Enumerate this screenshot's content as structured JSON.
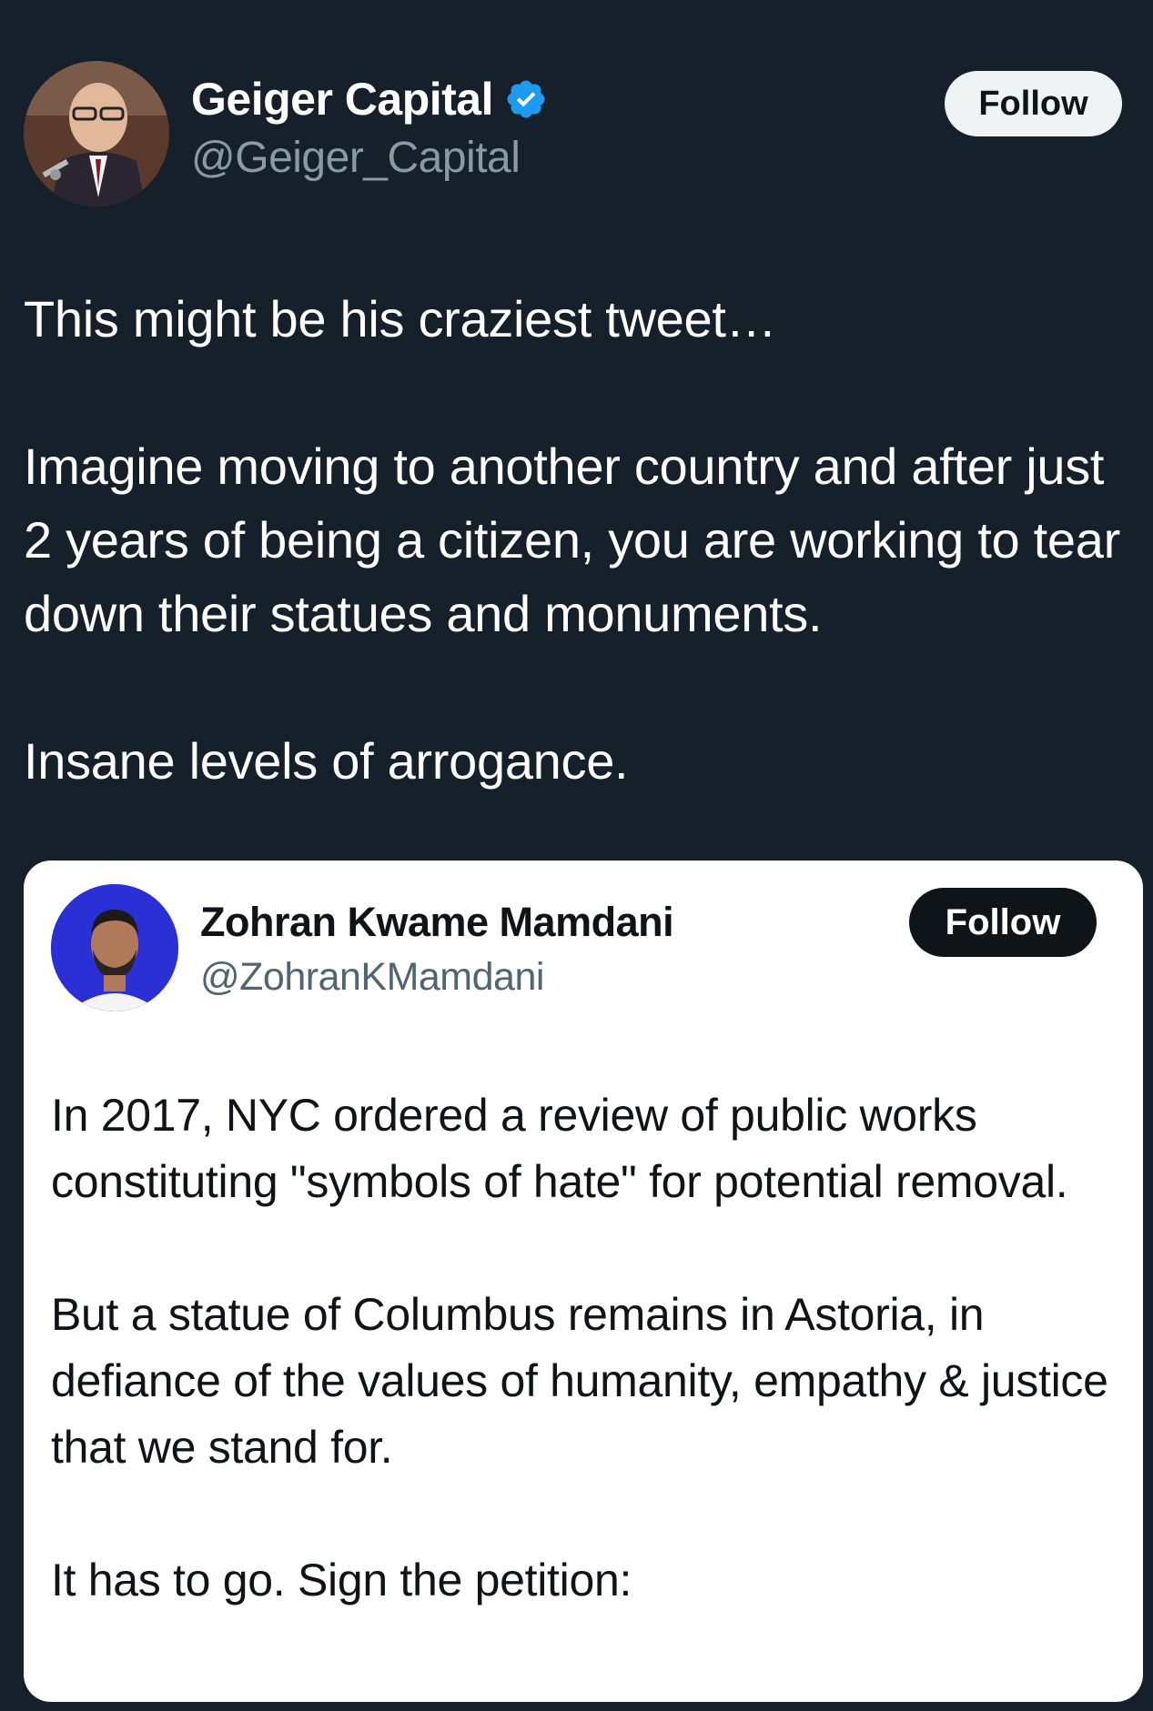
{
  "author": {
    "display_name": "Geiger Capital",
    "handle": "@Geiger_Capital",
    "verified": true,
    "follow_label": "Follow"
  },
  "tweet": {
    "paragraphs": [
      "This might be his craziest tweet…",
      "Imagine moving to another country and after just 2 years of being a citizen, you are working to tear down their statues and monuments.",
      "Insane levels of arrogance."
    ]
  },
  "quoted": {
    "display_name": "Zohran Kwame Mamdani",
    "handle": "@ZohranKMamdani",
    "follow_label": "Follow",
    "paragraphs": [
      "In 2017, NYC ordered a review of public works constituting \"symbols of hate\" for potential removal.",
      "But a statue of Columbus remains in Astoria, in defiance of the values of humanity, empathy & justice that we stand for.",
      "It has to go. Sign the petition:"
    ]
  },
  "colors": {
    "background": "#15202b",
    "verified_badge": "#1d9bf0",
    "handle_gray": "#8b98a5"
  }
}
